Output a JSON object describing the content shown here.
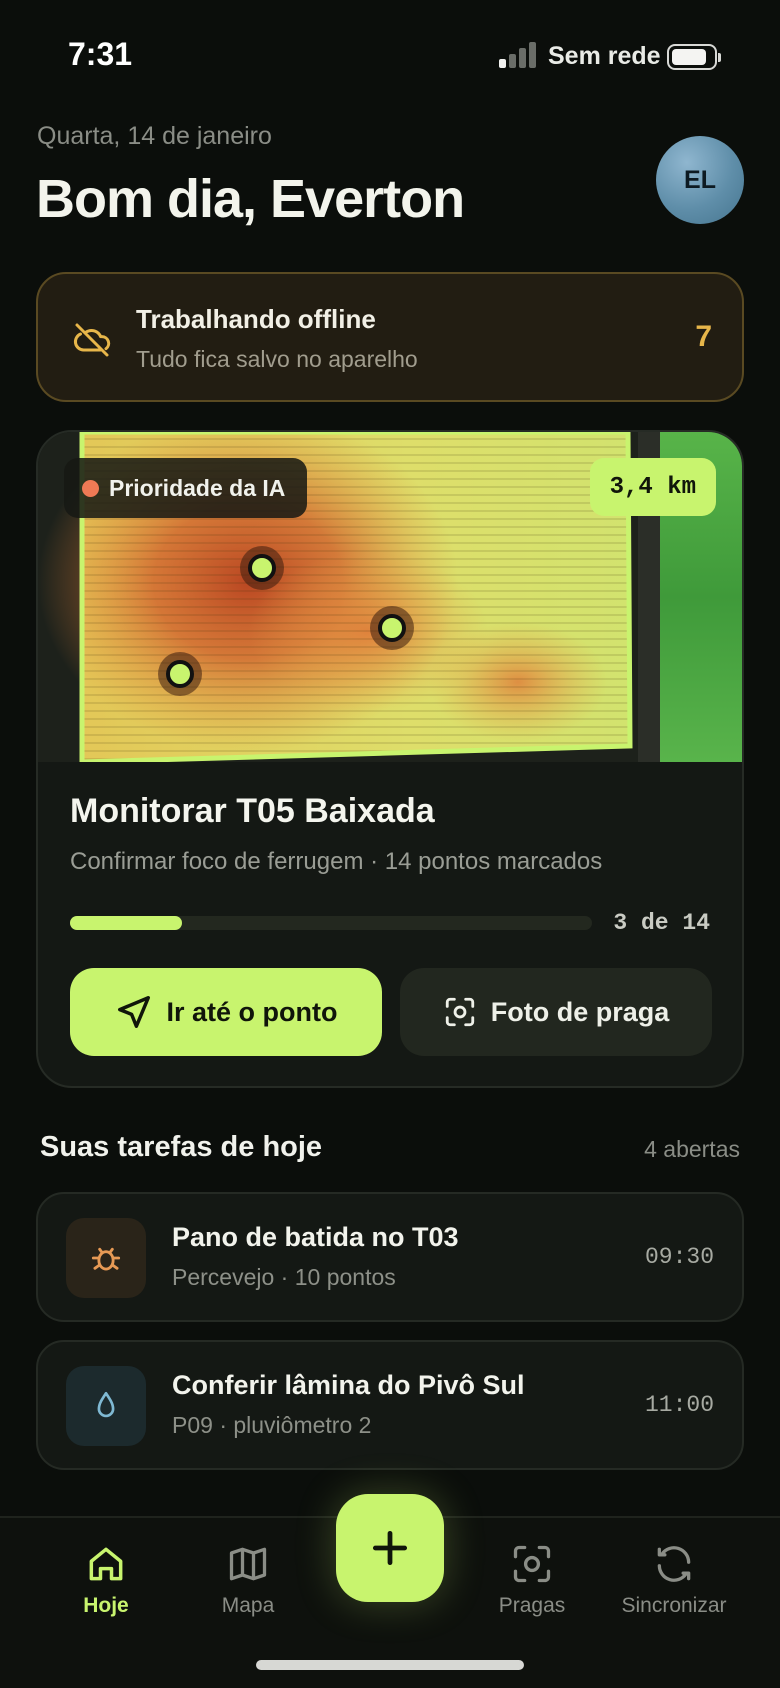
{
  "status_bar": {
    "time": "7:31",
    "network": "Sem rede"
  },
  "header": {
    "date": "Quarta, 14 de janeiro",
    "greeting": "Bom dia, Everton",
    "avatar_initials": "EL"
  },
  "offline_banner": {
    "title": "Trabalhando offline",
    "subtitle": "Tudo fica salvo no aparelho",
    "pending_count": "7",
    "icon": "cloud-off-icon"
  },
  "task_card": {
    "priority_badge": "Prioridade da IA",
    "distance": "3,4 km",
    "title": "Monitorar T05 Baixada",
    "subtitle": "Confirmar foco de ferrugem · 14 pontos marcados",
    "progress": {
      "done": 3,
      "total": 14,
      "label": "3 de 14"
    },
    "primary_button": "Ir até o ponto",
    "secondary_button": "Foto de praga"
  },
  "tasks_section": {
    "title": "Suas tarefas de hoje",
    "count_label": "4 abertas",
    "items": [
      {
        "name": "Pano de batida no T03",
        "detail": "Percevejo · 10 pontos",
        "time": "09:30",
        "icon": "bug-icon"
      },
      {
        "name": "Conferir lâmina do Pivô Sul",
        "detail": "P09 · pluviômetro 2",
        "time": "11:00",
        "icon": "water-drop-icon"
      }
    ]
  },
  "bottom_nav": {
    "items": [
      {
        "label": "Hoje",
        "icon": "home-icon",
        "active": true
      },
      {
        "label": "Mapa",
        "icon": "map-icon",
        "active": false
      },
      {
        "label": "Pragas",
        "icon": "scan-icon",
        "active": false
      },
      {
        "label": "Sincronizar",
        "icon": "sync-icon",
        "active": false
      }
    ],
    "fab_icon": "plus-icon"
  },
  "colors": {
    "accent": "#c8f46e",
    "warning": "#e7b64a",
    "background": "#0b0e0b",
    "card": "#141814"
  }
}
